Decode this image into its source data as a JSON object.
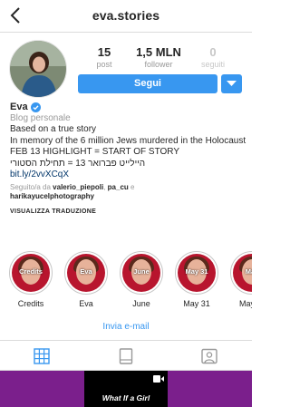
{
  "header": {
    "username": "eva.stories"
  },
  "stats": {
    "posts": {
      "value": "15",
      "label": "post"
    },
    "followers": {
      "value": "1,5 MLN",
      "label": "follower"
    },
    "following": {
      "value": "0",
      "label": "seguiti"
    }
  },
  "actions": {
    "follow_label": "Segui"
  },
  "profile": {
    "name": "Eva",
    "category": "Blog personale",
    "bio_lines": [
      "Based on a true story",
      "In memory of the 6 million Jews murdered in the Holocaust",
      "FEB 13 HIGHLIGHT = START OF STORY",
      "היילייט פברואר 13 = תחילת הסטורי"
    ],
    "link": "bit.ly/2vvXCqX",
    "followed_prefix": "Seguito/a da",
    "followed_user1": "valerio_piepoli",
    "followed_sep": ",",
    "followed_user2": "pa_cu",
    "followed_and": "e",
    "followed_user3": "harikayucelphotography",
    "translate_label": "VISUALIZZA TRADUZIONE"
  },
  "highlights": [
    {
      "cover": "Credits",
      "label": "Credits"
    },
    {
      "cover": "Eva",
      "label": "Eva"
    },
    {
      "cover": "June",
      "label": "June"
    },
    {
      "cover": "May 31",
      "label": "May 31"
    },
    {
      "cover": "May",
      "label": "May"
    }
  ],
  "email_label": "Invia e-mail",
  "tabs": [
    "grid-icon",
    "feed-icon",
    "tagged-icon"
  ],
  "media": {
    "video_text": "What If a Girl"
  },
  "colors": {
    "accent": "#3897f0",
    "highlight_bg": "#b8152e",
    "media_bg": "#7b1f8c"
  }
}
